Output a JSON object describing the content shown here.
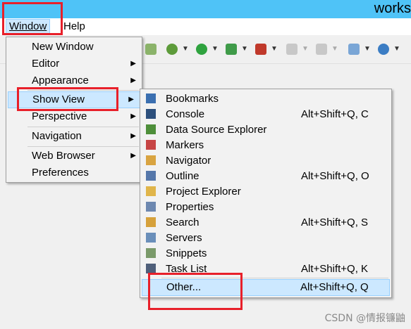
{
  "window": {
    "title": "works"
  },
  "menubar": {
    "window_label": "Window",
    "help_label": "Help"
  },
  "window_menu": {
    "items": [
      {
        "label": "New Window",
        "submenu": false
      },
      {
        "label": "Editor",
        "submenu": true
      },
      {
        "label": "Appearance",
        "submenu": true
      },
      {
        "label": "Show View",
        "submenu": true,
        "selected": true
      },
      {
        "label": "Perspective",
        "submenu": true
      },
      {
        "label": "Navigation",
        "submenu": true
      },
      {
        "label": "Web Browser",
        "submenu": true
      },
      {
        "label": "Preferences",
        "submenu": false
      }
    ]
  },
  "show_view_menu": {
    "items": [
      {
        "label": "Bookmarks",
        "shortcut": "",
        "icon": "bookmarks-icon"
      },
      {
        "label": "Console",
        "shortcut": "Alt+Shift+Q, C",
        "icon": "console-icon"
      },
      {
        "label": "Data Source Explorer",
        "shortcut": "",
        "icon": "data-source-icon"
      },
      {
        "label": "Markers",
        "shortcut": "",
        "icon": "markers-icon"
      },
      {
        "label": "Navigator",
        "shortcut": "",
        "icon": "navigator-icon"
      },
      {
        "label": "Outline",
        "shortcut": "Alt+Shift+Q, O",
        "icon": "outline-icon"
      },
      {
        "label": "Project Explorer",
        "shortcut": "",
        "icon": "project-explorer-icon"
      },
      {
        "label": "Properties",
        "shortcut": "",
        "icon": "properties-icon"
      },
      {
        "label": "Search",
        "shortcut": "Alt+Shift+Q, S",
        "icon": "search-icon"
      },
      {
        "label": "Servers",
        "shortcut": "",
        "icon": "servers-icon"
      },
      {
        "label": "Snippets",
        "shortcut": "",
        "icon": "snippets-icon"
      },
      {
        "label": "Task List",
        "shortcut": "Alt+Shift+Q, K",
        "icon": "task-list-icon"
      },
      {
        "label": "Other...",
        "shortcut": "Alt+Shift+Q, Q",
        "icon": "",
        "selected": true
      }
    ]
  },
  "watermark": "CSDN @情报镰鼬"
}
